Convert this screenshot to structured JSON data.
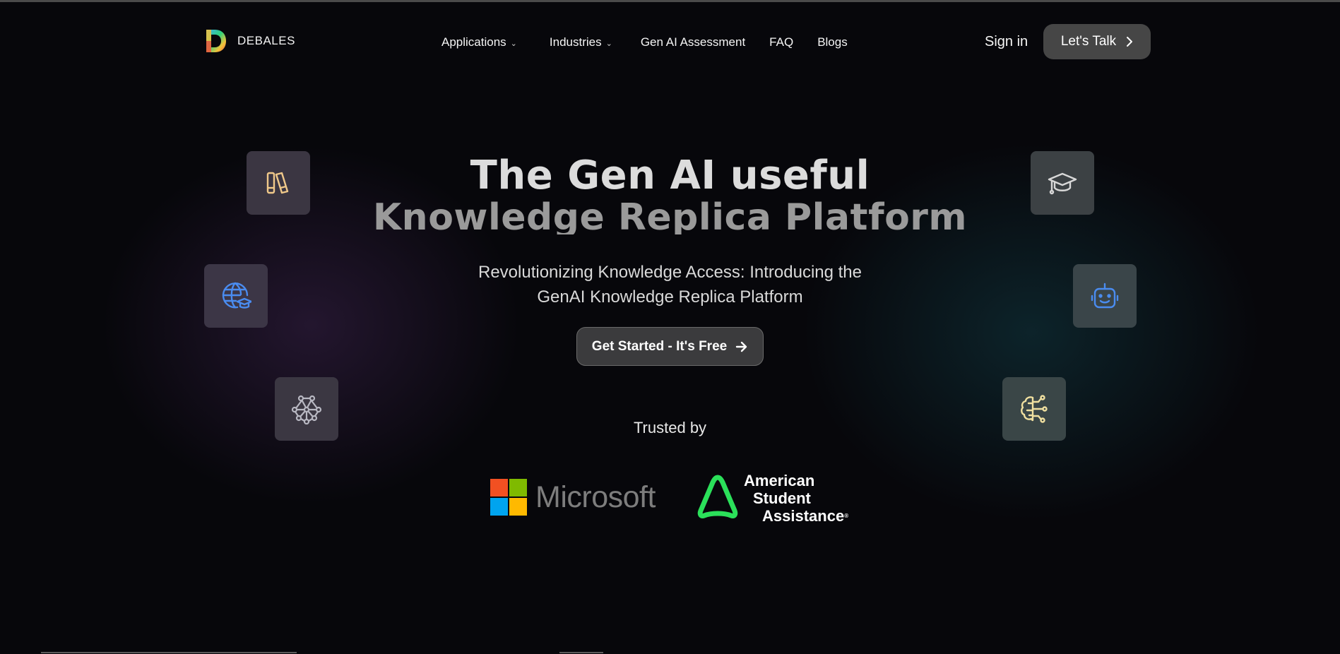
{
  "brand": {
    "name": "DEBALES"
  },
  "nav": {
    "items": [
      {
        "label": "Applications",
        "has_dropdown": true
      },
      {
        "label": "Industries",
        "has_dropdown": true
      },
      {
        "label": "Gen AI Assessment",
        "has_dropdown": false
      },
      {
        "label": "FAQ",
        "has_dropdown": false
      },
      {
        "label": "Blogs",
        "has_dropdown": false
      }
    ],
    "sign_in": "Sign in",
    "cta": "Let's Talk"
  },
  "hero": {
    "title_line1": "The Gen AI useful",
    "title_line2": "Knowledge Replica Platform",
    "subtitle_line1": "Revolutionizing Knowledge Access: Introducing the",
    "subtitle_line2": "GenAI Knowledge Replica Platform",
    "cta": "Get Started - It's Free"
  },
  "feature_icons": [
    {
      "icon": "books-icon",
      "color": "#f0c98a"
    },
    {
      "icon": "globe-graduation-icon",
      "color": "#4a8cf0"
    },
    {
      "icon": "network-icon",
      "color": "#b8b8c2"
    },
    {
      "icon": "graduation-cap-icon",
      "color": "#d8d8d8"
    },
    {
      "icon": "robot-icon",
      "color": "#4a8cf0"
    },
    {
      "icon": "brain-circuit-icon",
      "color": "#f0e0a0"
    }
  ],
  "trusted": {
    "heading": "Trusted by",
    "microsoft": "Microsoft",
    "asa_line1": "American",
    "asa_line2": "Student",
    "asa_line3": "Assistance",
    "asa_reg": "®"
  },
  "colors": {
    "background": "#07070b",
    "button": "#464646",
    "asa_green": "#2be05a",
    "ms_red": "#f25022",
    "ms_green": "#7fba00",
    "ms_blue": "#00a4ef",
    "ms_yellow": "#ffb900"
  }
}
